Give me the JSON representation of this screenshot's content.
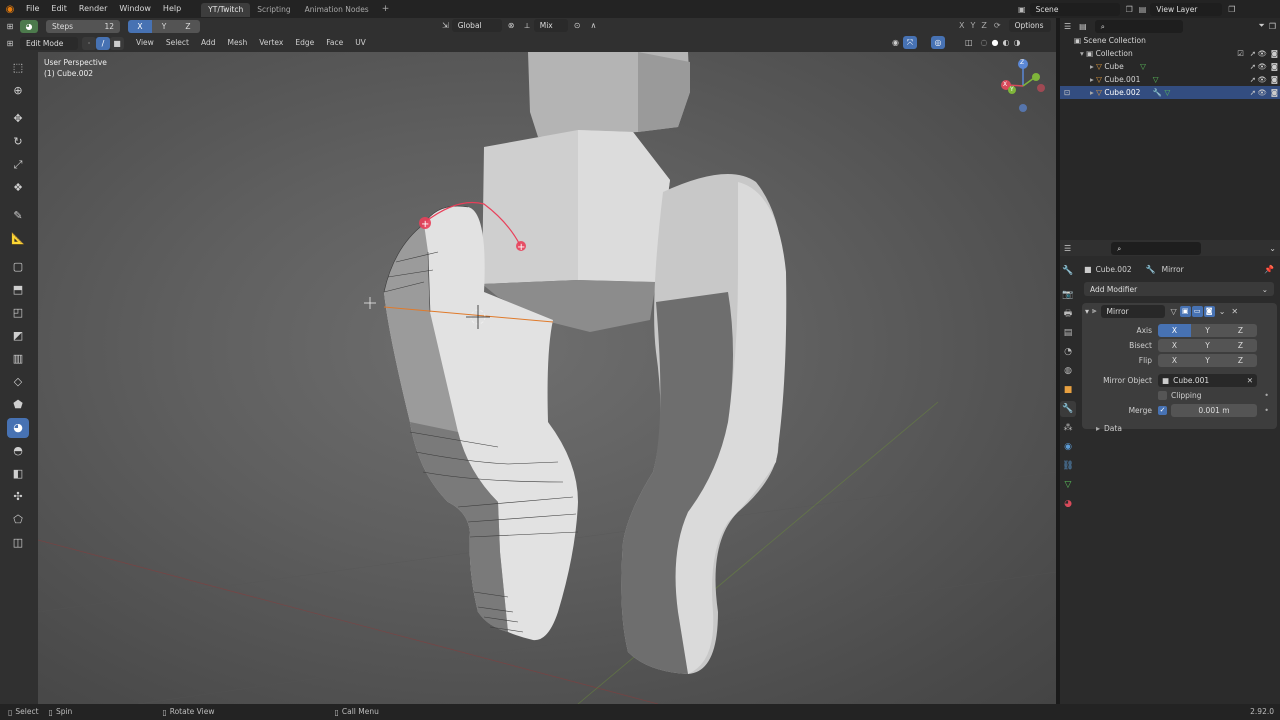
{
  "topbar": {
    "menus": [
      "File",
      "Edit",
      "Render",
      "Window",
      "Help"
    ],
    "tabs": [
      "YT/Twitch",
      "Scripting",
      "Animation Nodes"
    ],
    "active_tab": "YT/Twitch",
    "steps_label": "Steps",
    "steps_value": "12",
    "axes": [
      "X",
      "Y",
      "Z"
    ],
    "orientation": "Global",
    "mix": "Mix",
    "scene_label": "Scene",
    "view_layer_label": "View Layer",
    "options_label": "Options",
    "xyz_right": [
      "X",
      "Y",
      "Z"
    ]
  },
  "header": {
    "mode": "Edit Mode",
    "menus": [
      "View",
      "Select",
      "Add",
      "Mesh",
      "Vertex",
      "Edge",
      "Face",
      "UV"
    ]
  },
  "viewport": {
    "perspective": "User Perspective",
    "object_label": "(1) Cube.002",
    "gizmo": {
      "x": "X",
      "y": "Y",
      "z": "Z"
    }
  },
  "outliner": {
    "scene_collection": "Scene Collection",
    "collection": "Collection",
    "objects": [
      "Cube",
      "Cube.001",
      "Cube.002"
    ],
    "selected": "Cube.002"
  },
  "properties": {
    "object": "Cube.002",
    "modifier_label": "Mirror",
    "add_modifier": "Add Modifier",
    "panel_name": "Mirror",
    "axis_label": "Axis",
    "bisect_label": "Bisect",
    "flip_label": "Flip",
    "axes": [
      "X",
      "Y",
      "Z"
    ],
    "mirror_object_label": "Mirror Object",
    "mirror_object": "Cube.001",
    "clipping_label": "Clipping",
    "merge_label": "Merge",
    "merge_value": "0.001 m",
    "data_label": "Data"
  },
  "status": {
    "select": "Select",
    "spin": "Spin",
    "rotate_view": "Rotate View",
    "call_menu": "Call Menu",
    "version": "2.92.0"
  },
  "colors": {
    "accent": "#4772b3",
    "selected_row": "#334d80",
    "panel_bg": "#2b2b2b",
    "toolbar_bg": "#303030"
  }
}
